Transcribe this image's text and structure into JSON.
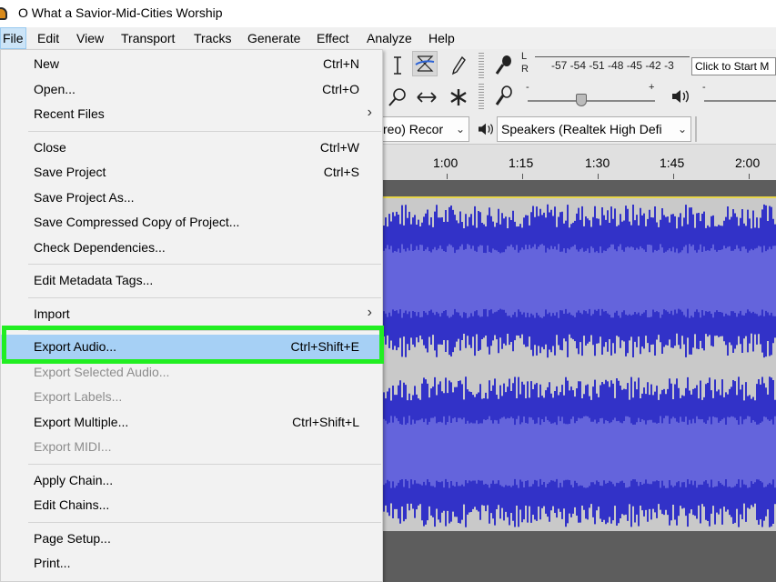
{
  "window": {
    "title": "O What a Savior-Mid-Cities Worship"
  },
  "menubar": [
    {
      "label": "File",
      "active": true
    },
    {
      "label": "Edit"
    },
    {
      "label": "View"
    },
    {
      "label": "Transport"
    },
    {
      "label": "Tracks"
    },
    {
      "label": "Generate"
    },
    {
      "label": "Effect"
    },
    {
      "label": "Analyze"
    },
    {
      "label": "Help"
    }
  ],
  "toolbar": {
    "meter_scale": "-57 -54 -51 -48 -45 -42 -3",
    "meter_lr": [
      "L",
      "R"
    ],
    "monitor_button": "Click to Start M",
    "recording_device": "reo) Recor",
    "playback_device": "Speakers (Realtek High Defi",
    "playback_slider_marks": [
      "-",
      "+"
    ],
    "dash": "-"
  },
  "timeline": {
    "labels": [
      "1:00",
      "1:15",
      "1:30",
      "1:45",
      "2:00"
    ]
  },
  "file_menu": {
    "items": [
      {
        "label": "New",
        "shortcut": "Ctrl+N"
      },
      {
        "label": "Open...",
        "shortcut": "Ctrl+O"
      },
      {
        "label": "Recent Files",
        "submenu": true
      },
      {
        "separator": true
      },
      {
        "label": "Close",
        "shortcut": "Ctrl+W"
      },
      {
        "label": "Save Project",
        "shortcut": "Ctrl+S"
      },
      {
        "label": "Save Project As..."
      },
      {
        "label": "Save Compressed Copy of Project..."
      },
      {
        "label": "Check Dependencies..."
      },
      {
        "separator": true
      },
      {
        "label": "Edit Metadata Tags..."
      },
      {
        "separator": true
      },
      {
        "label": "Import",
        "submenu": true
      },
      {
        "separator": true
      },
      {
        "label": "Export Audio...",
        "shortcut": "Ctrl+Shift+E",
        "highlighted": true
      },
      {
        "label": "Export Selected Audio...",
        "disabled": true
      },
      {
        "label": "Export Labels...",
        "disabled": true
      },
      {
        "label": "Export Multiple...",
        "shortcut": "Ctrl+Shift+L"
      },
      {
        "label": "Export MIDI...",
        "disabled": true
      },
      {
        "separator": true
      },
      {
        "label": "Apply Chain..."
      },
      {
        "label": "Edit Chains..."
      },
      {
        "separator": true
      },
      {
        "label": "Page Setup..."
      },
      {
        "label": "Print..."
      }
    ]
  },
  "colors": {
    "highlight_outline": "#22ee22",
    "waveform_dark": "#3232c8",
    "waveform_light": "#6464dc",
    "track_bg": "#c9c9c9",
    "menu_highlight": "#a6d0f5"
  }
}
